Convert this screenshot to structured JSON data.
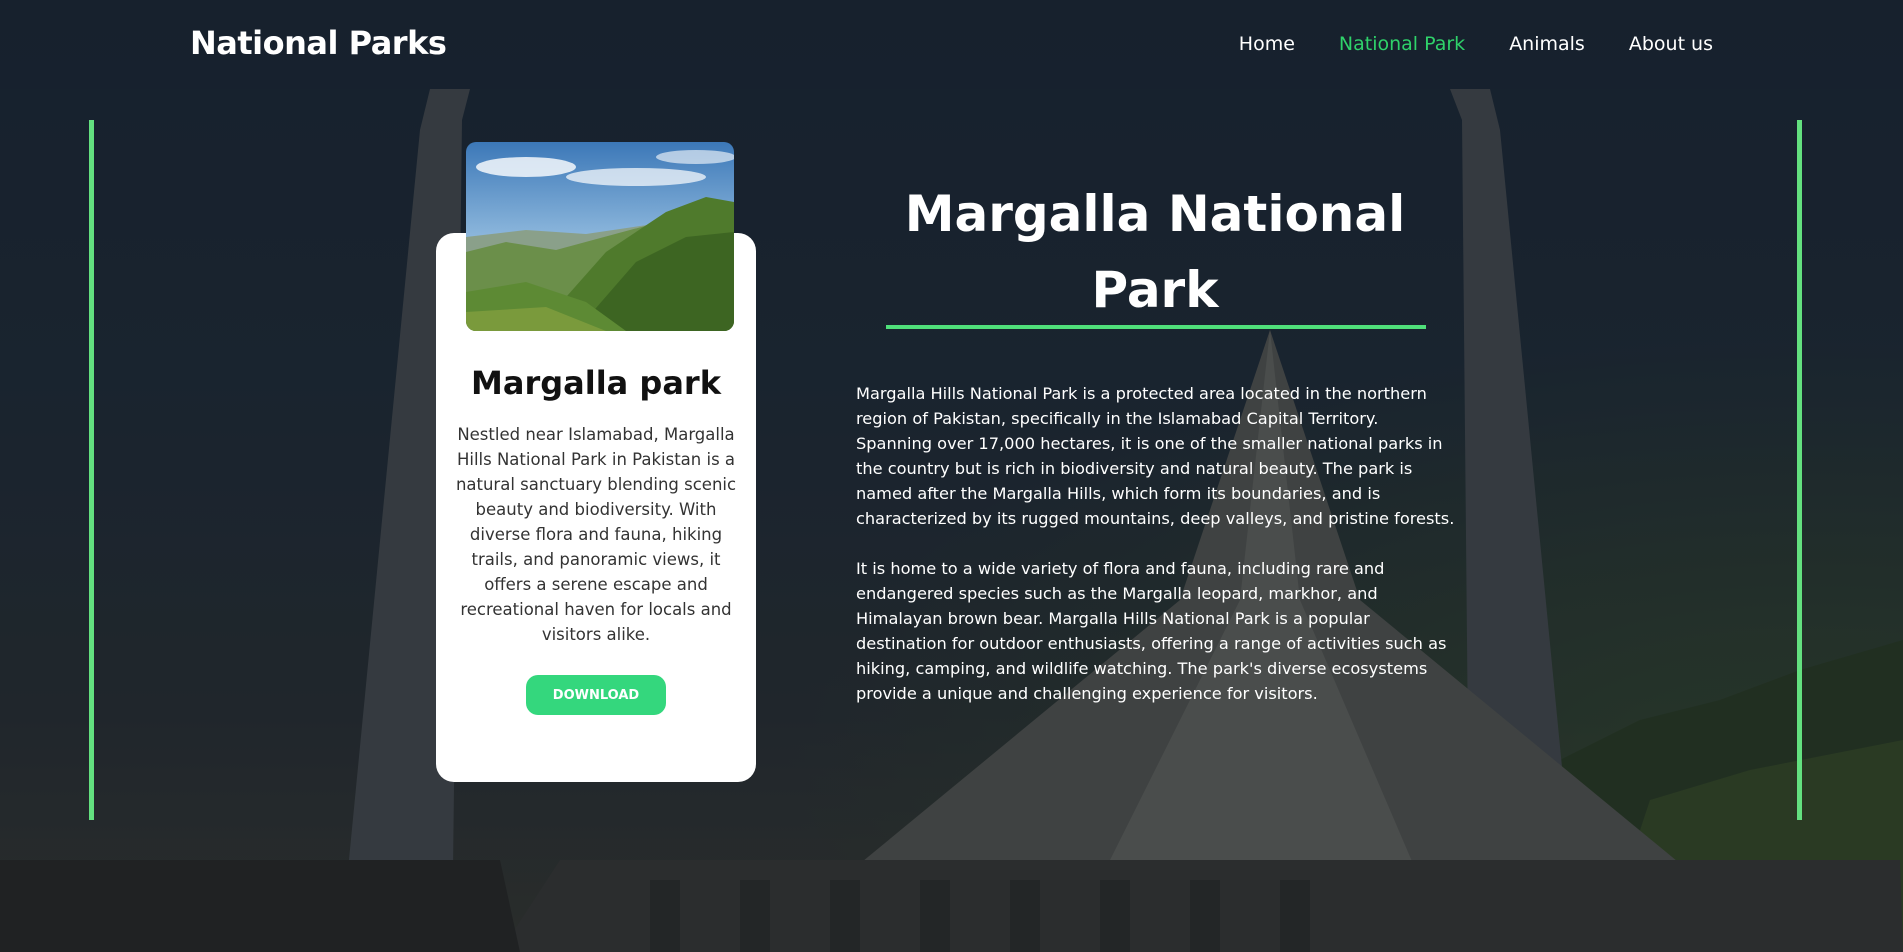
{
  "header": {
    "brand": "National Parks",
    "nav": [
      {
        "label": "Home",
        "active": false
      },
      {
        "label": "National Park",
        "active": true
      },
      {
        "label": "Animals",
        "active": false
      },
      {
        "label": "About us",
        "active": false
      }
    ]
  },
  "card": {
    "image_icon": "mountain-landscape-photo",
    "title": "Margalla park",
    "description": "Nestled near Islamabad, Margalla Hills National Park in Pakistan is a natural sanctuary blending scenic beauty and biodiversity. With diverse flora and fauna, hiking trails, and panoramic views, it offers a serene escape and recreational haven for locals and visitors alike.",
    "button_label": "DOWNLOAD"
  },
  "main": {
    "title": "Margalla National Park",
    "paragraphs": [
      "Margalla Hills National Park is a protected area located in the northern region of Pakistan, specifically in the Islamabad Capital Territory. Spanning over 17,000 hectares, it is one of the smaller national parks in the country but is rich in biodiversity and natural beauty. The park is named after the Margalla Hills, which form its boundaries, and is characterized by its rugged mountains, deep valleys, and pristine forests.",
      "It is home to a wide variety of flora and fauna, including rare and endangered species such as the Margalla leopard, markhor, and Himalayan brown bear. Margalla Hills National Park is a popular destination for outdoor enthusiasts, offering a range of activities such as hiking, camping, and wildlife watching. The park's diverse ecosystems provide a unique and challenging experience for visitors."
    ]
  },
  "colors": {
    "accent": "#2fd26a",
    "button": "#34d77d",
    "side_lines": "#63e07f",
    "navbar_bg": "#18212e"
  }
}
